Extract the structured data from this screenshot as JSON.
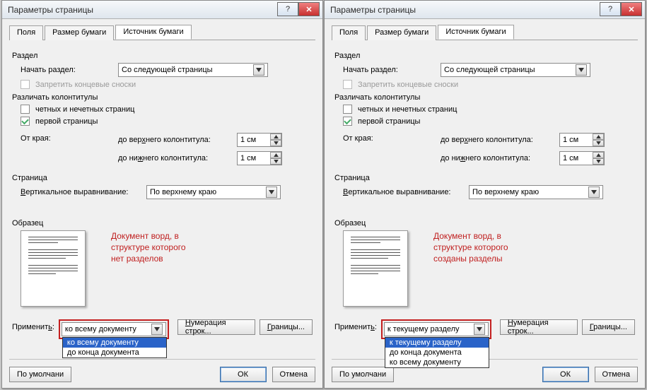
{
  "dialog_title": "Параметры страницы",
  "tabs": {
    "fields": "Поля",
    "paper_size": "Размер бумаги",
    "paper_source": "Источник бумаги"
  },
  "section": {
    "section_hdr": "Раздел",
    "start_label": "Начать раздел:",
    "start_value": "Со следующей страницы",
    "suppress": "Запретить концевые сноски"
  },
  "headers": {
    "hdr": "Различать колонтитулы",
    "odd_even": "четных и нечетных страниц",
    "first_page": "первой страницы",
    "from_edge": "От края:",
    "to_header": "до верхнего колонтитула:",
    "to_footer": "до нижнего колонтитула:",
    "header_val": "1 см",
    "footer_val": "1 см"
  },
  "page": {
    "hdr": "Страница",
    "valign_label": "Вертикальное выравнивание:",
    "valign_value": "По верхнему краю"
  },
  "preview_hdr": "Образец",
  "apply": {
    "label": "Применить:",
    "left_value": "ко всему документу",
    "left_options": [
      "ко всему документу",
      "до конца документа"
    ],
    "right_value": "к текущему разделу",
    "right_options": [
      "к текущему разделу",
      "до конца документа",
      "ко всему документу"
    ]
  },
  "buttons": {
    "line_numbers": "Нумерация строк...",
    "borders": "Границы...",
    "defaults": "По умолчани",
    "ok": "ОК",
    "cancel": "Отмена"
  },
  "annotation": {
    "left_l1": "Документ ворд, в",
    "left_l2": "структуре которого",
    "left_l3": "нет разделов",
    "right_l1": "Документ ворд, в",
    "right_l2": "структуре которого",
    "right_l3": "созданы разделы"
  }
}
